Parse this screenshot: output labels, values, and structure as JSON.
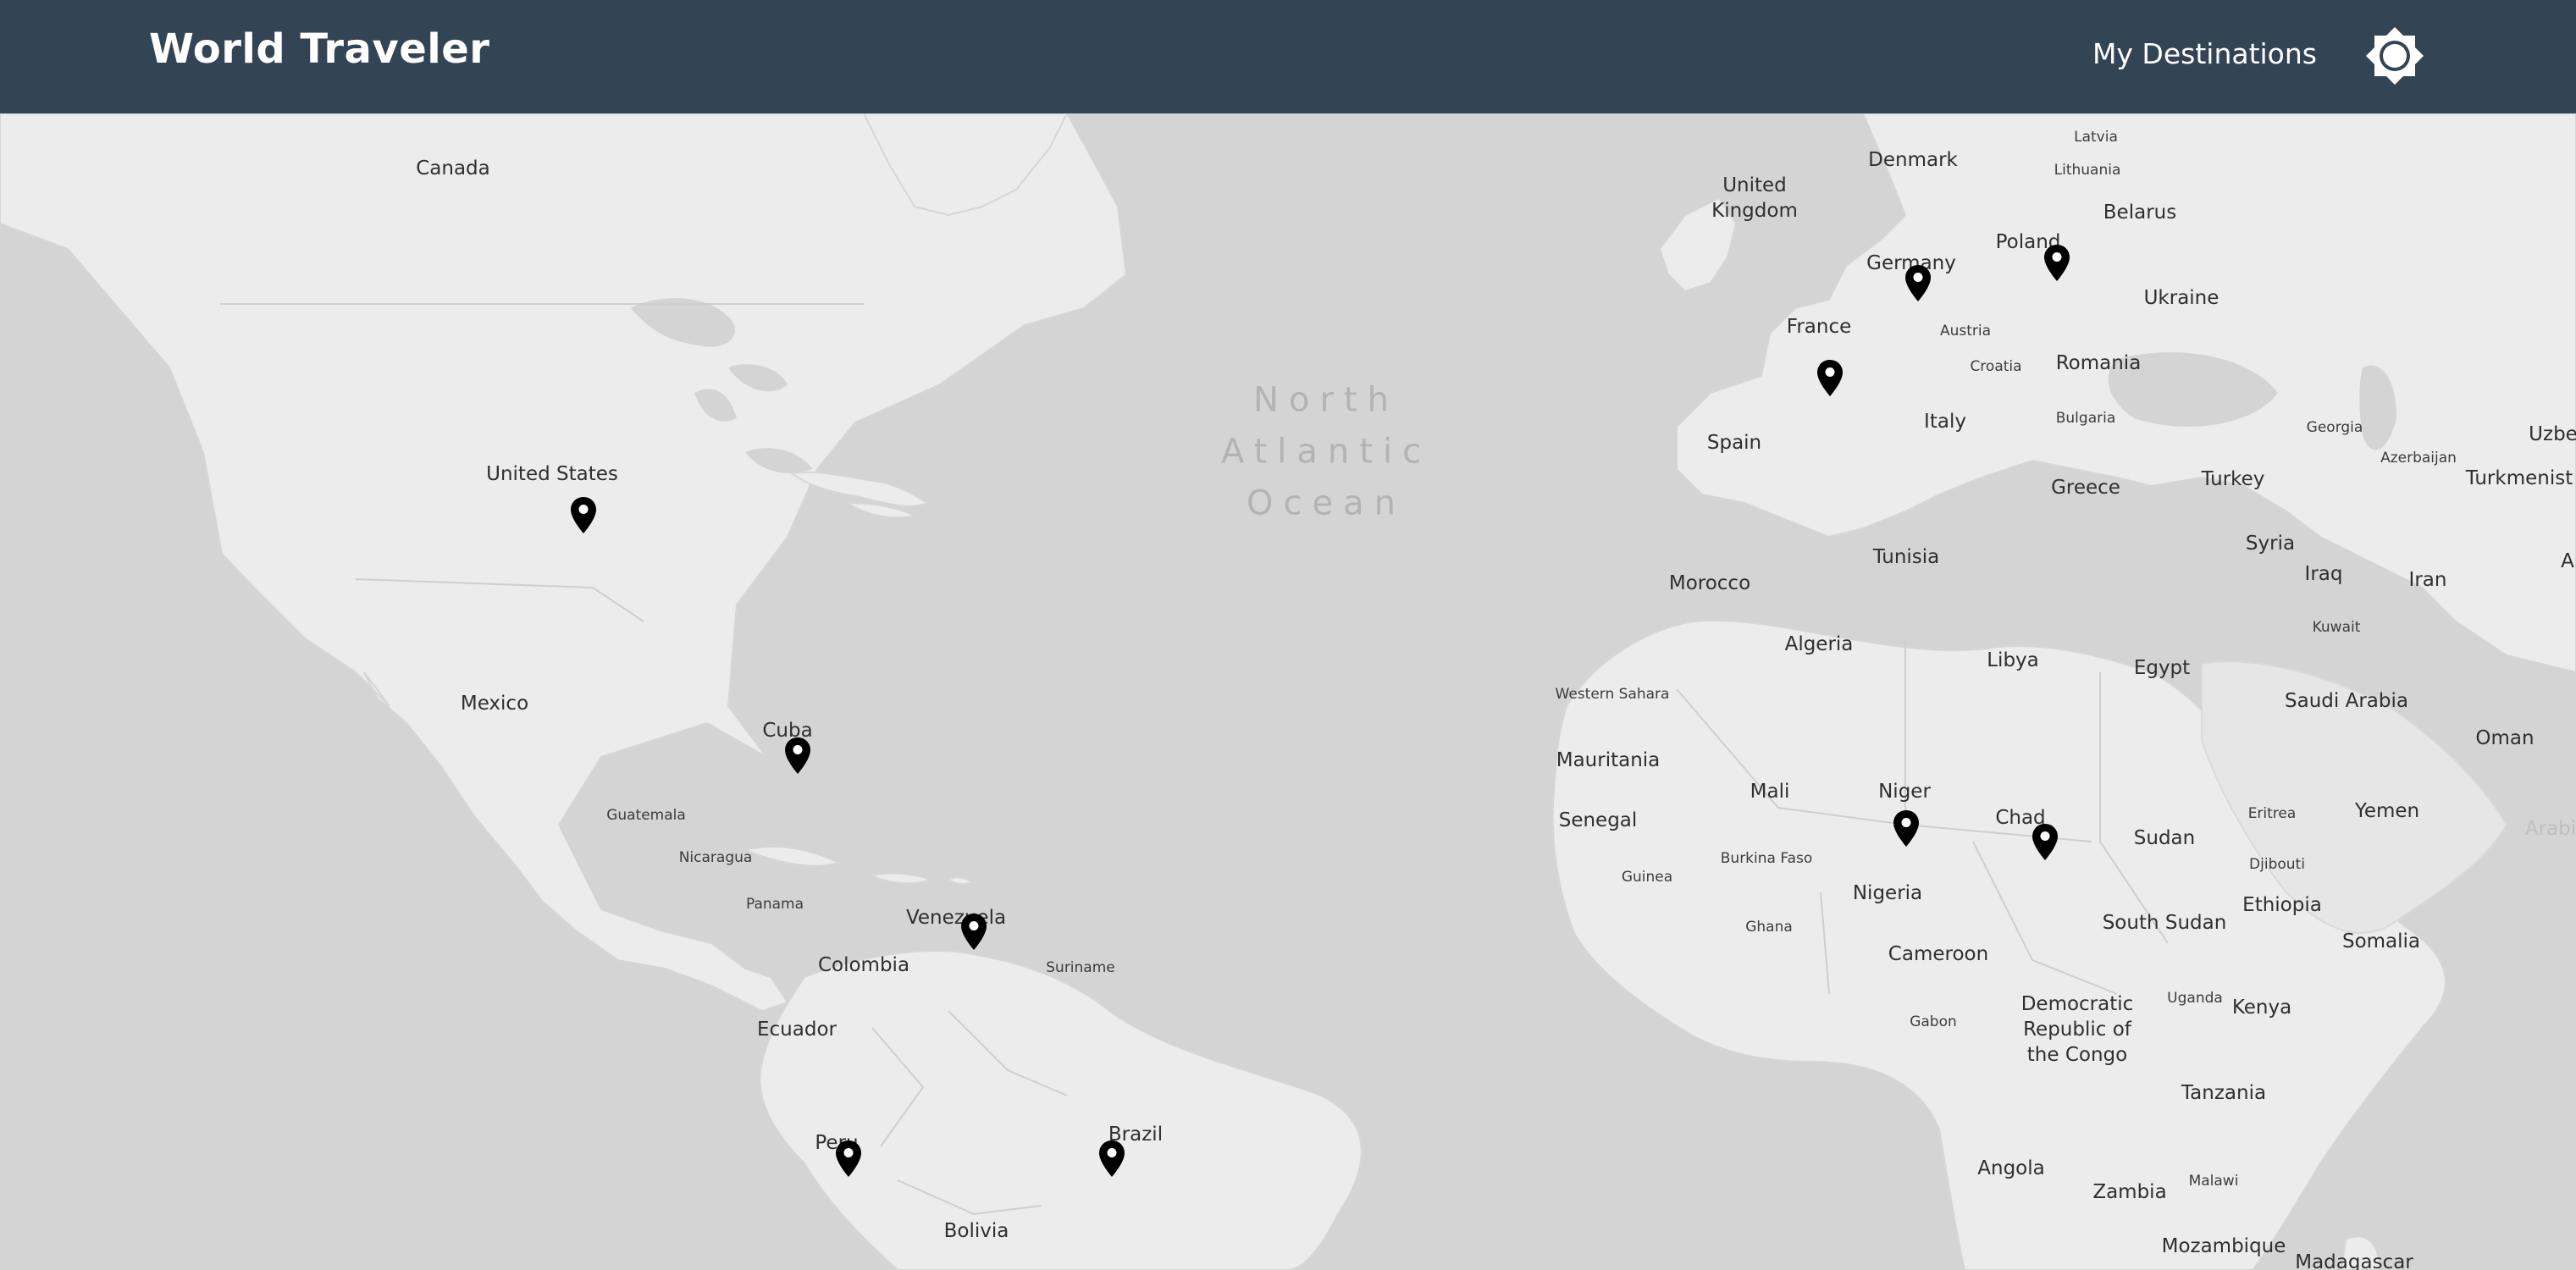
{
  "header": {
    "title": "World Traveler",
    "nav_link": "My Destinations",
    "theme_icon": "sun-icon"
  },
  "map": {
    "ocean_label": "North\nAtlantic\nOcean",
    "country_labels": {
      "canada": "Canada",
      "united_states": "United States",
      "mexico": "Mexico",
      "cuba": "Cuba",
      "guatemala": "Guatemala",
      "nicaragua": "Nicaragua",
      "panama": "Panama",
      "venezuela": "Venezuela",
      "colombia": "Colombia",
      "suriname": "Suriname",
      "ecuador": "Ecuador",
      "peru": "Peru",
      "brazil": "Brazil",
      "bolivia": "Bolivia",
      "united_kingdom": "United\nKingdom",
      "denmark": "Denmark",
      "latvia": "Latvia",
      "lithuania": "Lithuania",
      "belarus": "Belarus",
      "poland": "Poland",
      "germany": "Germany",
      "ukraine": "Ukraine",
      "austria": "Austria",
      "france": "France",
      "croatia": "Croatia",
      "romania": "Romania",
      "spain": "Spain",
      "italy": "Italy",
      "bulgaria": "Bulgaria",
      "georgia": "Georgia",
      "uzbekistan_partial": "Uzbe",
      "azerbaijan": "Azerbaijan",
      "turkmenistan_partial": "Turkmenist",
      "greece": "Greece",
      "turkey": "Turkey",
      "tunisia": "Tunisia",
      "syria": "Syria",
      "morocco": "Morocco",
      "iraq": "Iraq",
      "iran": "Iran",
      "partial_a": "A",
      "algeria": "Algeria",
      "libya": "Libya",
      "egypt": "Egypt",
      "kuwait": "Kuwait",
      "western_sahara": "Western Sahara",
      "saudi_arabia": "Saudi Arabia",
      "oman": "Oman",
      "mauritania": "Mauritania",
      "mali": "Mali",
      "niger": "Niger",
      "eritrea": "Eritrea",
      "yemen": "Yemen",
      "arabian_partial": "Arabi",
      "senegal": "Senegal",
      "chad": "Chad",
      "sudan": "Sudan",
      "burkina_faso": "Burkina Faso",
      "djibouti": "Djibouti",
      "guinea": "Guinea",
      "nigeria": "Nigeria",
      "ethiopia": "Ethiopia",
      "ghana": "Ghana",
      "south_sudan": "South Sudan",
      "somalia": "Somalia",
      "cameroon": "Cameroon",
      "drc": "Democratic\nRepublic of\nthe Congo",
      "uganda": "Uganda",
      "kenya": "Kenya",
      "gabon": "Gabon",
      "tanzania": "Tanzania",
      "angola": "Angola",
      "malawi": "Malawi",
      "zambia": "Zambia",
      "mozambique": "Mozambique",
      "madagascar": "Madagascar"
    },
    "pins": [
      {
        "name": "destination-pin-united-states",
        "icon": "map-pin-icon"
      },
      {
        "name": "destination-pin-cuba",
        "icon": "map-pin-icon"
      },
      {
        "name": "destination-pin-venezuela",
        "icon": "map-pin-icon"
      },
      {
        "name": "destination-pin-peru",
        "icon": "map-pin-icon"
      },
      {
        "name": "destination-pin-brazil",
        "icon": "map-pin-icon"
      },
      {
        "name": "destination-pin-germany",
        "icon": "map-pin-icon"
      },
      {
        "name": "destination-pin-poland",
        "icon": "map-pin-icon"
      },
      {
        "name": "destination-pin-france",
        "icon": "map-pin-icon"
      },
      {
        "name": "destination-pin-niger",
        "icon": "map-pin-icon"
      },
      {
        "name": "destination-pin-chad",
        "icon": "map-pin-icon"
      }
    ]
  },
  "colors": {
    "header_bg": "#334455",
    "ocean": "#d4d4d4",
    "land": "#ececec",
    "pin": "#000000"
  }
}
